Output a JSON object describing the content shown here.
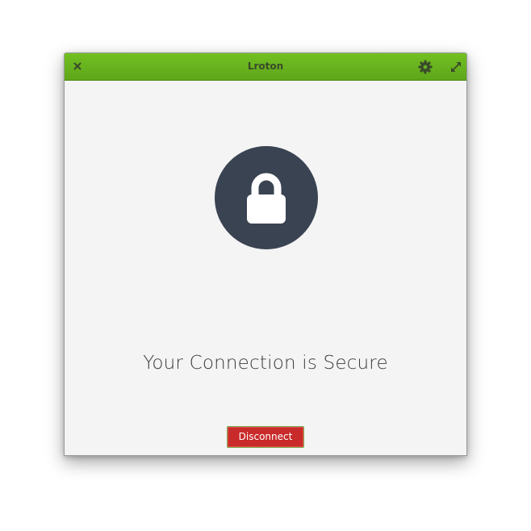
{
  "window": {
    "title": "Lroton",
    "accent_color": "#5ea61a",
    "background_color": "#f4f4f4"
  },
  "titlebar": {
    "close_icon": "close-icon",
    "settings_icon": "gear-icon",
    "maximize_icon": "maximize-icon"
  },
  "main": {
    "status_icon": "lock-icon",
    "status_icon_color": "#3a4352",
    "status_text": "Your Connection is Secure",
    "disconnect_label": "Disconnect",
    "disconnect_color": "#c92a2a"
  }
}
